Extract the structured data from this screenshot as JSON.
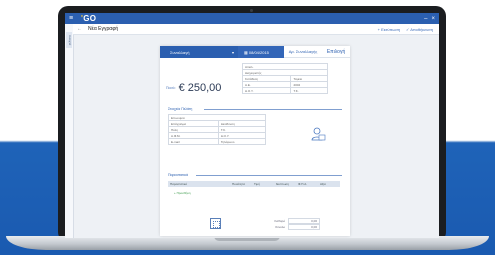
{
  "app": {
    "brand_prefix": "'",
    "brand": "GO"
  },
  "window": {
    "min_label": "–",
    "close_label": "×"
  },
  "rail": {
    "tab_label": "Ανοιχτά"
  },
  "toolbar": {
    "back": "←",
    "title": "Νέα Εγγραφή",
    "btn1": "+ Εκτύπωση",
    "btn2": "✓ Αποθήκευση"
  },
  "doc": {
    "head_seg1": "Συναλλαγή",
    "head_caret": "▾",
    "head_seg2": "▦ 08/04/2015",
    "head_seg3a": "Αρ. Συναλλαγής",
    "head_seg3b": "Επιλογή",
    "amount_label": "Ποσό:",
    "amount_value": "€ 250,00",
    "top_grid": [
      [
        "Αιτιολ.",
        ""
      ],
      [
        "Διαχειριστής",
        ""
      ],
      [
        "Κατάθεση",
        "Ταμείο"
      ],
      [
        "Α.Ε.",
        "2002"
      ],
      [
        "Δ.Ο.Υ.",
        "Τ.Κ."
      ]
    ],
    "section1": "Στοιχεία Πελάτη",
    "mid_grid": [
      [
        "Επωνυμία",
        ""
      ],
      [
        "Επάγγελμα",
        "Διεύθυνση"
      ],
      [
        "Πόλη",
        "Τ.Κ."
      ],
      [
        "Α.Φ.Μ.",
        "Δ.Ο.Υ."
      ],
      [
        "E-mail",
        "Τηλέφωνο"
      ]
    ],
    "section2": "Παραστατικά",
    "table_cols": [
      "Παραστατικό",
      "Ποσότητα",
      "Τιμή",
      "Έκπτωση",
      "Φ.Π.Α.",
      "Αξία"
    ],
    "add_label": "+ Προσθήκη",
    "totals": [
      {
        "k": "Καθαρό",
        "v": "0,00"
      },
      {
        "k": "Σύνολο",
        "v": "0,00"
      }
    ]
  }
}
